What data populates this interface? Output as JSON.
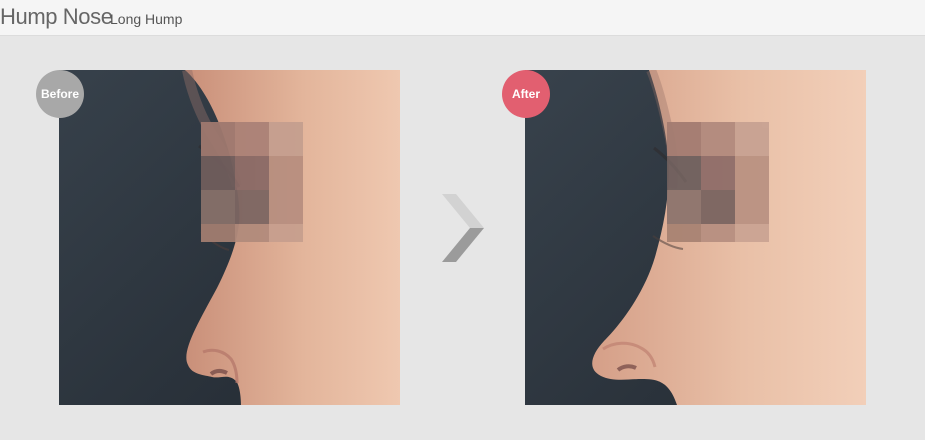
{
  "header": {
    "title": "Hump Nose",
    "subtitle": "Long Hump"
  },
  "before": {
    "badge_label": "Before",
    "image_semantic": "side-profile-face-before"
  },
  "after": {
    "badge_label": "After",
    "image_semantic": "side-profile-face-after"
  },
  "navigation": {
    "arrow_icon": "chevron-right-icon"
  },
  "colors": {
    "before_badge": "#a8a8a8",
    "after_badge": "#e25f70",
    "background": "#e6e6e6",
    "header": "#f5f5f5"
  }
}
